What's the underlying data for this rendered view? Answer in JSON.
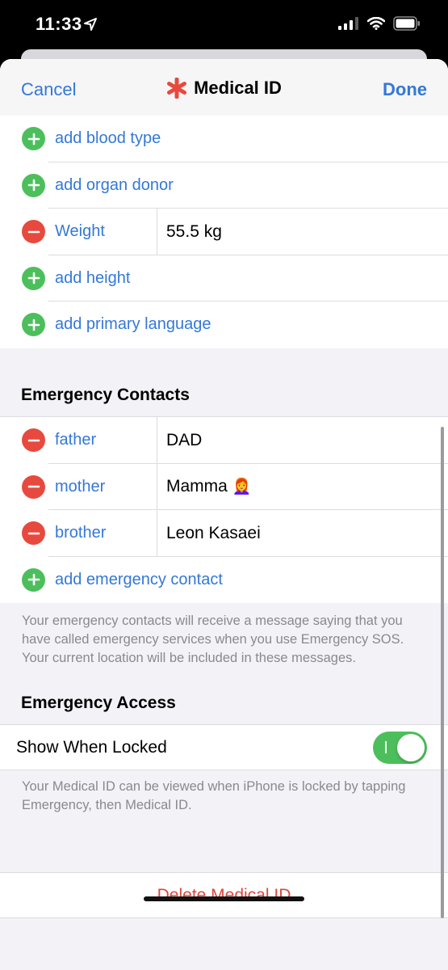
{
  "status": {
    "time": "11:33",
    "icons": [
      "location-arrow-icon",
      "cellular-signal-icon",
      "wifi-icon",
      "battery-icon"
    ]
  },
  "nav": {
    "cancel": "Cancel",
    "title": "Medical ID",
    "title_icon": "medical-star-icon",
    "done": "Done"
  },
  "medical": {
    "rows": [
      {
        "kind": "add",
        "label": "add blood type"
      },
      {
        "kind": "add",
        "label": "add organ donor"
      },
      {
        "kind": "remove",
        "label": "Weight",
        "value": "55.5 kg"
      },
      {
        "kind": "add",
        "label": "add height"
      },
      {
        "kind": "add",
        "label": "add primary language"
      }
    ]
  },
  "contacts": {
    "header": "Emergency Contacts",
    "rows": [
      {
        "kind": "remove",
        "label": "father",
        "value": "DAD"
      },
      {
        "kind": "remove",
        "label": "mother",
        "value": "Mamma",
        "emoji": "👩‍🦰"
      },
      {
        "kind": "remove",
        "label": "brother",
        "value": "Leon Kasaei"
      },
      {
        "kind": "add",
        "label": "add emergency contact"
      }
    ],
    "footnote": "Your emergency contacts will receive a message saying that you have called emergency services when you use Emergency SOS. Your current location will be included in these messages."
  },
  "access": {
    "header": "Emergency Access",
    "toggle_label": "Show When Locked",
    "toggle_on": true,
    "footnote": "Your Medical ID can be viewed when iPhone is locked by tapping Emergency, then Medical ID."
  },
  "delete": {
    "label": "Delete Medical ID"
  },
  "colors": {
    "accent": "#3478d8",
    "add": "#4cbf5c",
    "remove": "#e8493e",
    "destructive": "#e0463c"
  }
}
